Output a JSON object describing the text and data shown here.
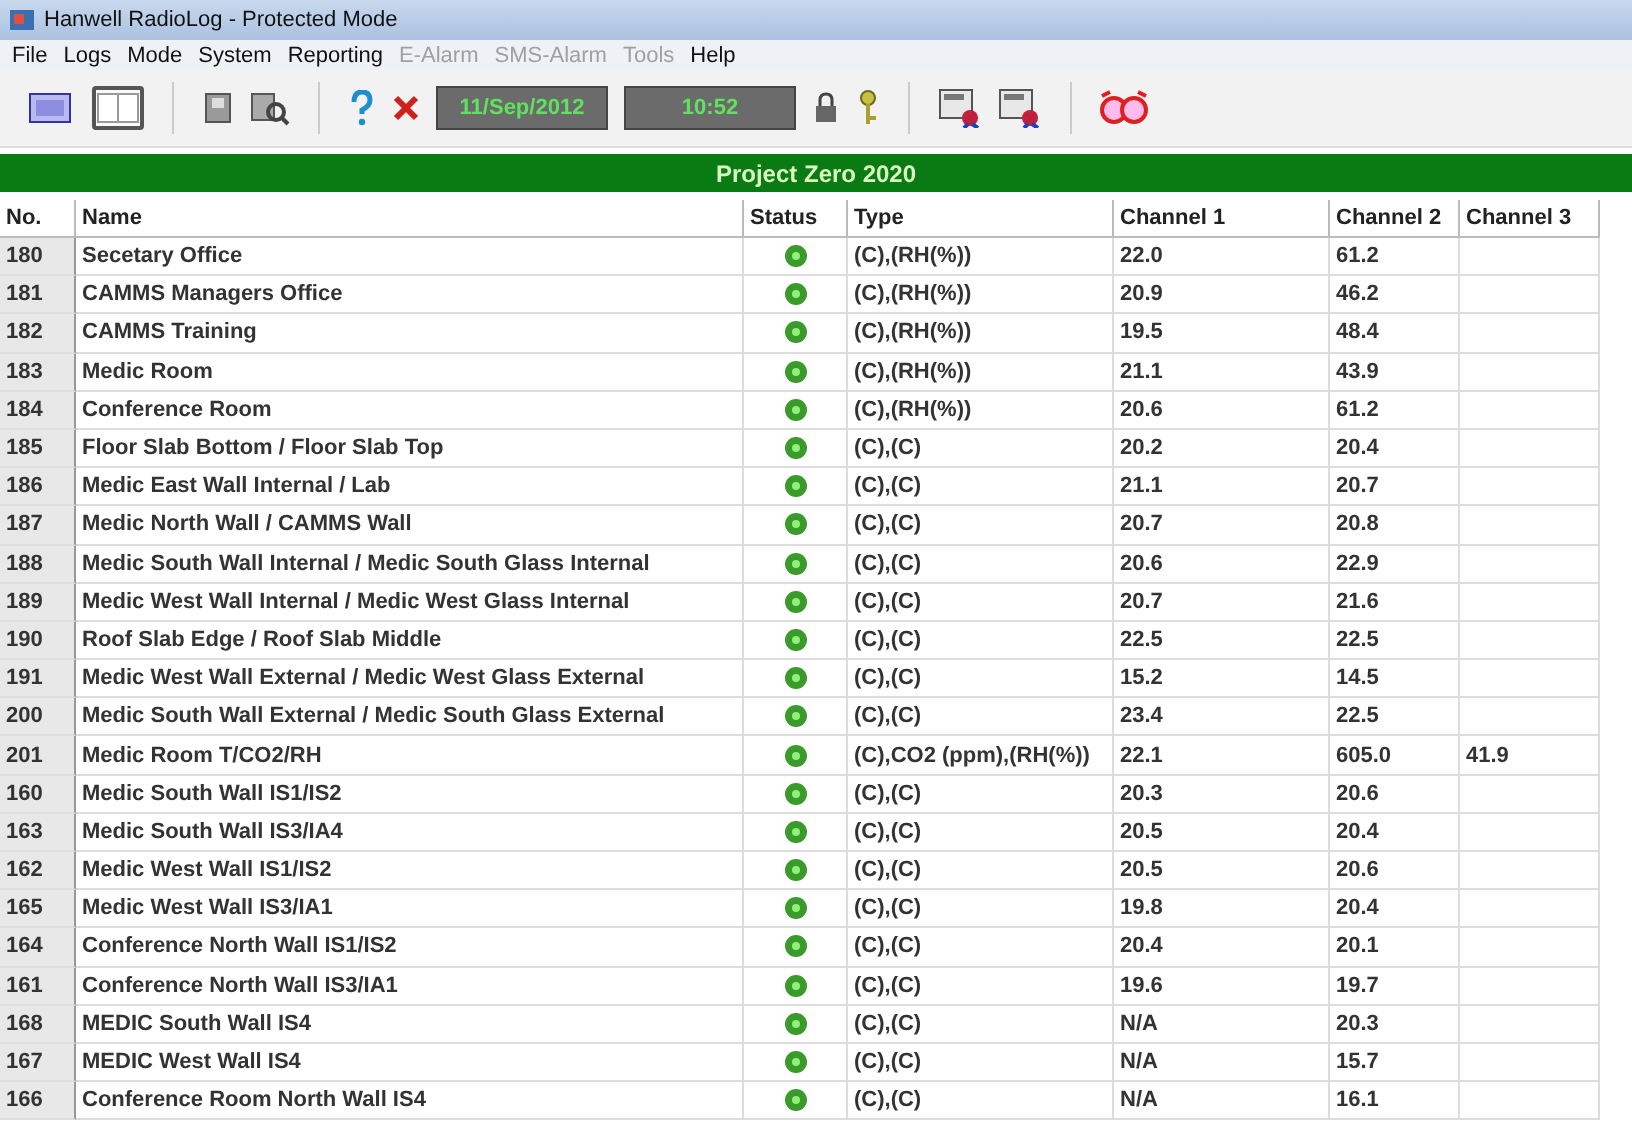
{
  "window": {
    "title": "Hanwell RadioLog - Protected Mode"
  },
  "menu": [
    {
      "label": "File",
      "disabled": false
    },
    {
      "label": "Logs",
      "disabled": false
    },
    {
      "label": "Mode",
      "disabled": false
    },
    {
      "label": "System",
      "disabled": false
    },
    {
      "label": "Reporting",
      "disabled": false
    },
    {
      "label": "E-Alarm",
      "disabled": true
    },
    {
      "label": "SMS-Alarm",
      "disabled": true
    },
    {
      "label": "Tools",
      "disabled": true
    },
    {
      "label": "Help",
      "disabled": false
    }
  ],
  "toolbar": {
    "view_buttons": [
      {
        "selected": false
      },
      {
        "selected": true
      }
    ],
    "date": "11/Sep/2012",
    "time": "10:52"
  },
  "banner": "Project Zero 2020",
  "table": {
    "columns": [
      "No.",
      "Name",
      "Status",
      "Type",
      "Channel 1",
      "Channel 2",
      "Channel 3"
    ],
    "rows": [
      {
        "no": "180",
        "name": "Secetary Office",
        "type": "(C),(RH(%))",
        "ch1": "22.0",
        "ch2": "61.2"
      },
      {
        "no": "181",
        "name": "CAMMS Managers Office",
        "type": "(C),(RH(%))",
        "ch1": "20.9",
        "ch2": "46.2"
      },
      {
        "no": "182",
        "name": "CAMMS Training",
        "type": "(C),(RH(%))",
        "ch1": "19.5",
        "ch2": "48.4"
      },
      {
        "no": "183",
        "name": "Medic Room",
        "type": "(C),(RH(%))",
        "ch1": "21.1",
        "ch2": "43.9"
      },
      {
        "no": "184",
        "name": "Conference Room",
        "type": "(C),(RH(%))",
        "ch1": "20.6",
        "ch2": "61.2"
      },
      {
        "no": "185",
        "name": "Floor Slab Bottom / Floor Slab Top",
        "type": "(C),(C)",
        "ch1": "20.2",
        "ch2": "20.4"
      },
      {
        "no": "186",
        "name": "Medic East Wall Internal / Lab",
        "type": "(C),(C)",
        "ch1": "21.1",
        "ch2": "20.7"
      },
      {
        "no": "187",
        "name": "Medic North Wall / CAMMS Wall",
        "type": "(C),(C)",
        "ch1": "20.7",
        "ch2": "20.8"
      },
      {
        "no": "188",
        "name": "Medic South Wall Internal / Medic South Glass Internal",
        "type": "(C),(C)",
        "ch1": "20.6",
        "ch2": "22.9"
      },
      {
        "no": "189",
        "name": "Medic West Wall Internal / Medic West Glass Internal",
        "type": "(C),(C)",
        "ch1": "20.7",
        "ch2": "21.6"
      },
      {
        "no": "190",
        "name": "Roof Slab Edge / Roof Slab Middle",
        "type": "(C),(C)",
        "ch1": "22.5",
        "ch2": "22.5"
      },
      {
        "no": "191",
        "name": "Medic West Wall External / Medic West Glass External",
        "type": "(C),(C)",
        "ch1": "15.2",
        "ch2": "14.5"
      },
      {
        "no": "200",
        "name": "Medic South Wall External / Medic South Glass External",
        "type": "(C),(C)",
        "ch1": "23.4",
        "ch2": "22.5"
      },
      {
        "no": "201",
        "name": "Medic Room T/CO2/RH",
        "type": "(C),CO2 (ppm),(RH(%))",
        "ch1": "22.1",
        "ch2": "605.0",
        "ch3": "41.9"
      },
      {
        "no": "160",
        "name": "Medic South Wall IS1/IS2",
        "type": "(C),(C)",
        "ch1": "20.3",
        "ch2": "20.6"
      },
      {
        "no": "163",
        "name": "Medic South Wall IS3/IA4",
        "type": "(C),(C)",
        "ch1": "20.5",
        "ch2": "20.4"
      },
      {
        "no": "162",
        "name": "Medic West Wall IS1/IS2",
        "type": "(C),(C)",
        "ch1": "20.5",
        "ch2": "20.6"
      },
      {
        "no": "165",
        "name": "Medic West Wall IS3/IA1",
        "type": "(C),(C)",
        "ch1": "19.8",
        "ch2": "20.4"
      },
      {
        "no": "164",
        "name": "Conference North Wall IS1/IS2",
        "type": "(C),(C)",
        "ch1": "20.4",
        "ch2": "20.1"
      },
      {
        "no": "161",
        "name": "Conference North Wall IS3/IA1",
        "type": "(C),(C)",
        "ch1": "19.6",
        "ch2": "19.7"
      },
      {
        "no": "168",
        "name": "MEDIC South Wall IS4",
        "type": "(C),(C)",
        "ch1": "N/A",
        "ch2": "20.3"
      },
      {
        "no": "167",
        "name": "MEDIC West Wall IS4",
        "type": "(C),(C)",
        "ch1": "N/A",
        "ch2": "15.7"
      },
      {
        "no": "166",
        "name": "Conference Room North Wall IS4",
        "type": "(C),(C)",
        "ch1": "N/A",
        "ch2": "16.1"
      }
    ]
  }
}
